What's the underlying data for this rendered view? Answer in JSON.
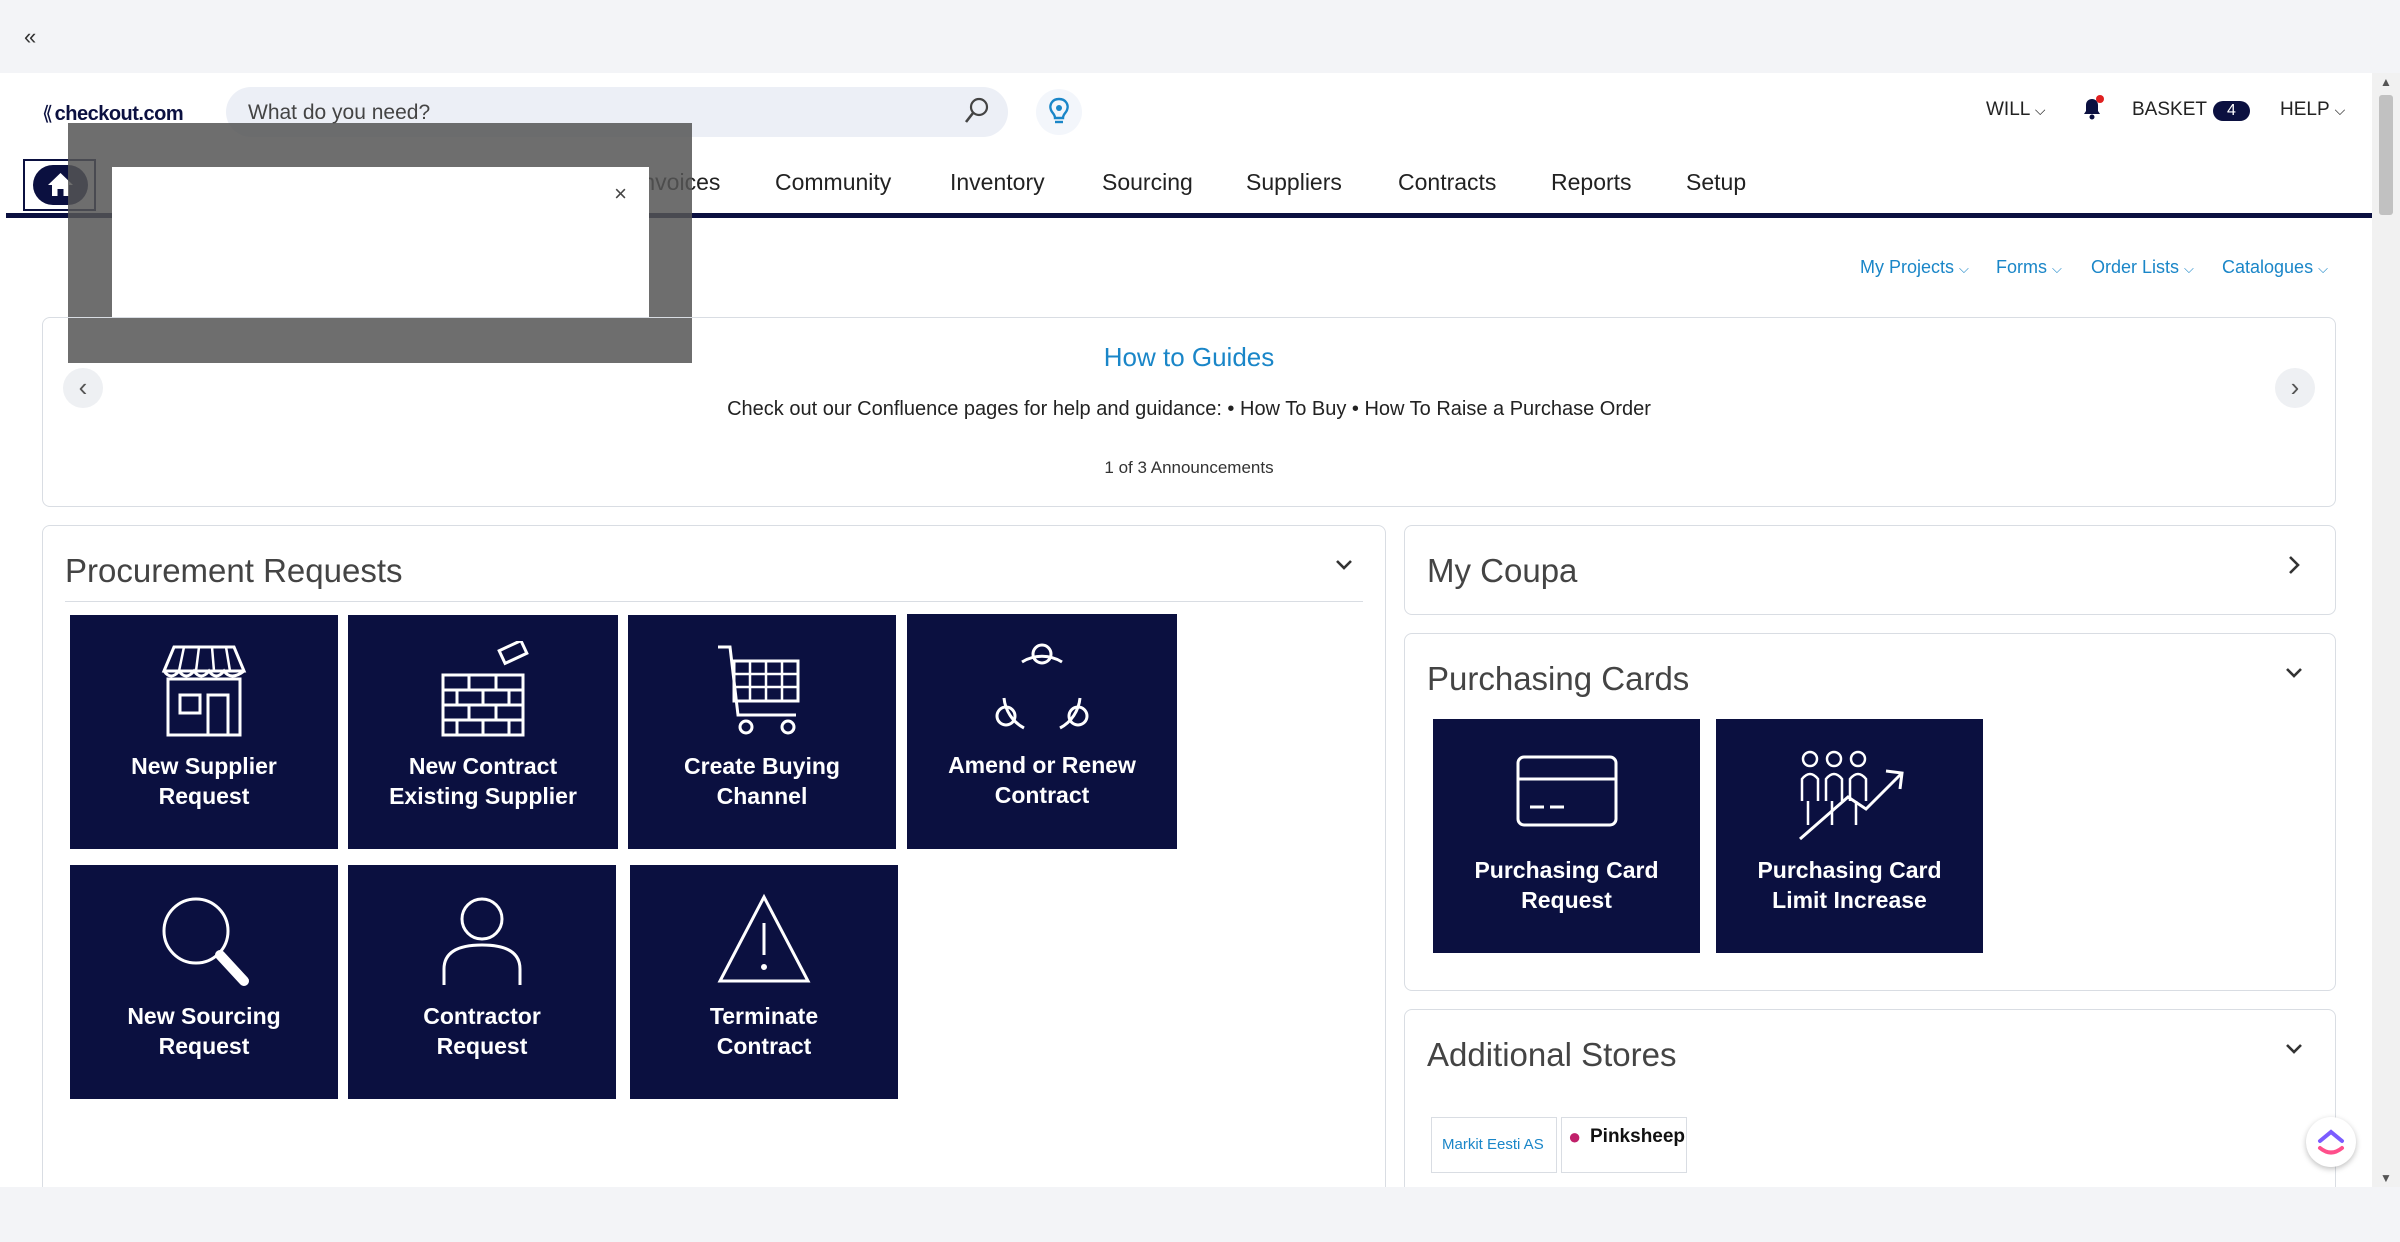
{
  "browser": {
    "mini_logo": "«"
  },
  "header": {
    "brand": "checkout.com",
    "search_placeholder": "What do you need?",
    "user": "WILL",
    "basket_label": "BASKET",
    "basket_count": "4",
    "help": "HELP"
  },
  "nav": {
    "items": [
      "Invoices",
      "Community",
      "Inventory",
      "Sourcing",
      "Suppliers",
      "Contracts",
      "Reports",
      "Setup"
    ]
  },
  "popup": {
    "close": "×"
  },
  "sublinks": [
    "My Projects",
    "Forms",
    "Order Lists",
    "Catalogues"
  ],
  "announcements": {
    "title": "How to Guides",
    "body": "Check out our Confluence pages for help and guidance: • How To Buy • How To Raise a Purchase Order",
    "count": "1 of 3 Announcements",
    "prev": "‹",
    "next": "›"
  },
  "procurement": {
    "title": "Procurement Requests",
    "tiles": [
      {
        "l1": "New Supplier",
        "l2": "Request",
        "icon": "shop-icon"
      },
      {
        "l1": "New Contract",
        "l2": "Existing Supplier",
        "icon": "brick-wall-icon"
      },
      {
        "l1": "Create Buying",
        "l2": "Channel",
        "icon": "cart-icon"
      },
      {
        "l1": "Amend or Renew",
        "l2": "Contract",
        "icon": "cycle-icon"
      },
      {
        "l1": "New Sourcing",
        "l2": "Request",
        "icon": "magnifier-icon"
      },
      {
        "l1": "Contractor",
        "l2": "Request",
        "icon": "person-icon"
      },
      {
        "l1": "Terminate",
        "l2": "Contract",
        "icon": "warning-icon"
      }
    ]
  },
  "my_coupa": {
    "title": "My Coupa"
  },
  "purchasing_cards": {
    "title": "Purchasing Cards",
    "tiles": [
      {
        "l1": "Purchasing Card",
        "l2": "Request",
        "icon": "credit-card-icon"
      },
      {
        "l1": "Purchasing Card",
        "l2": "Limit Increase",
        "icon": "people-growth-icon"
      }
    ]
  },
  "additional_stores": {
    "title": "Additional Stores",
    "stores": [
      "Markit Eesti AS",
      "Pinksheep"
    ]
  },
  "colors": {
    "navy": "#0b1040",
    "link": "#1a86c8"
  }
}
